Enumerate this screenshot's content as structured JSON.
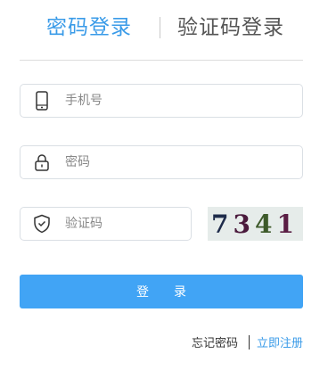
{
  "tabs": {
    "password_login": "密码登录",
    "sms_login": "验证码登录"
  },
  "form": {
    "phone_placeholder": "手机号",
    "password_placeholder": "密码",
    "captcha_placeholder": "验证码",
    "captcha_text": "7341"
  },
  "actions": {
    "login_label": "登录",
    "forgot_password": "忘记密码",
    "register": "立即注册"
  },
  "icons": {
    "phone": "phone-icon",
    "password": "lock-icon",
    "captcha": "shield-check-icon"
  },
  "colors": {
    "accent": "#3a9be8",
    "button": "#41a4f5",
    "captcha_bg": "#e6ecea",
    "captcha_digits": [
      "#1e2b4a",
      "#4a1a3c",
      "#3d5a2a",
      "#5a1e44"
    ]
  }
}
